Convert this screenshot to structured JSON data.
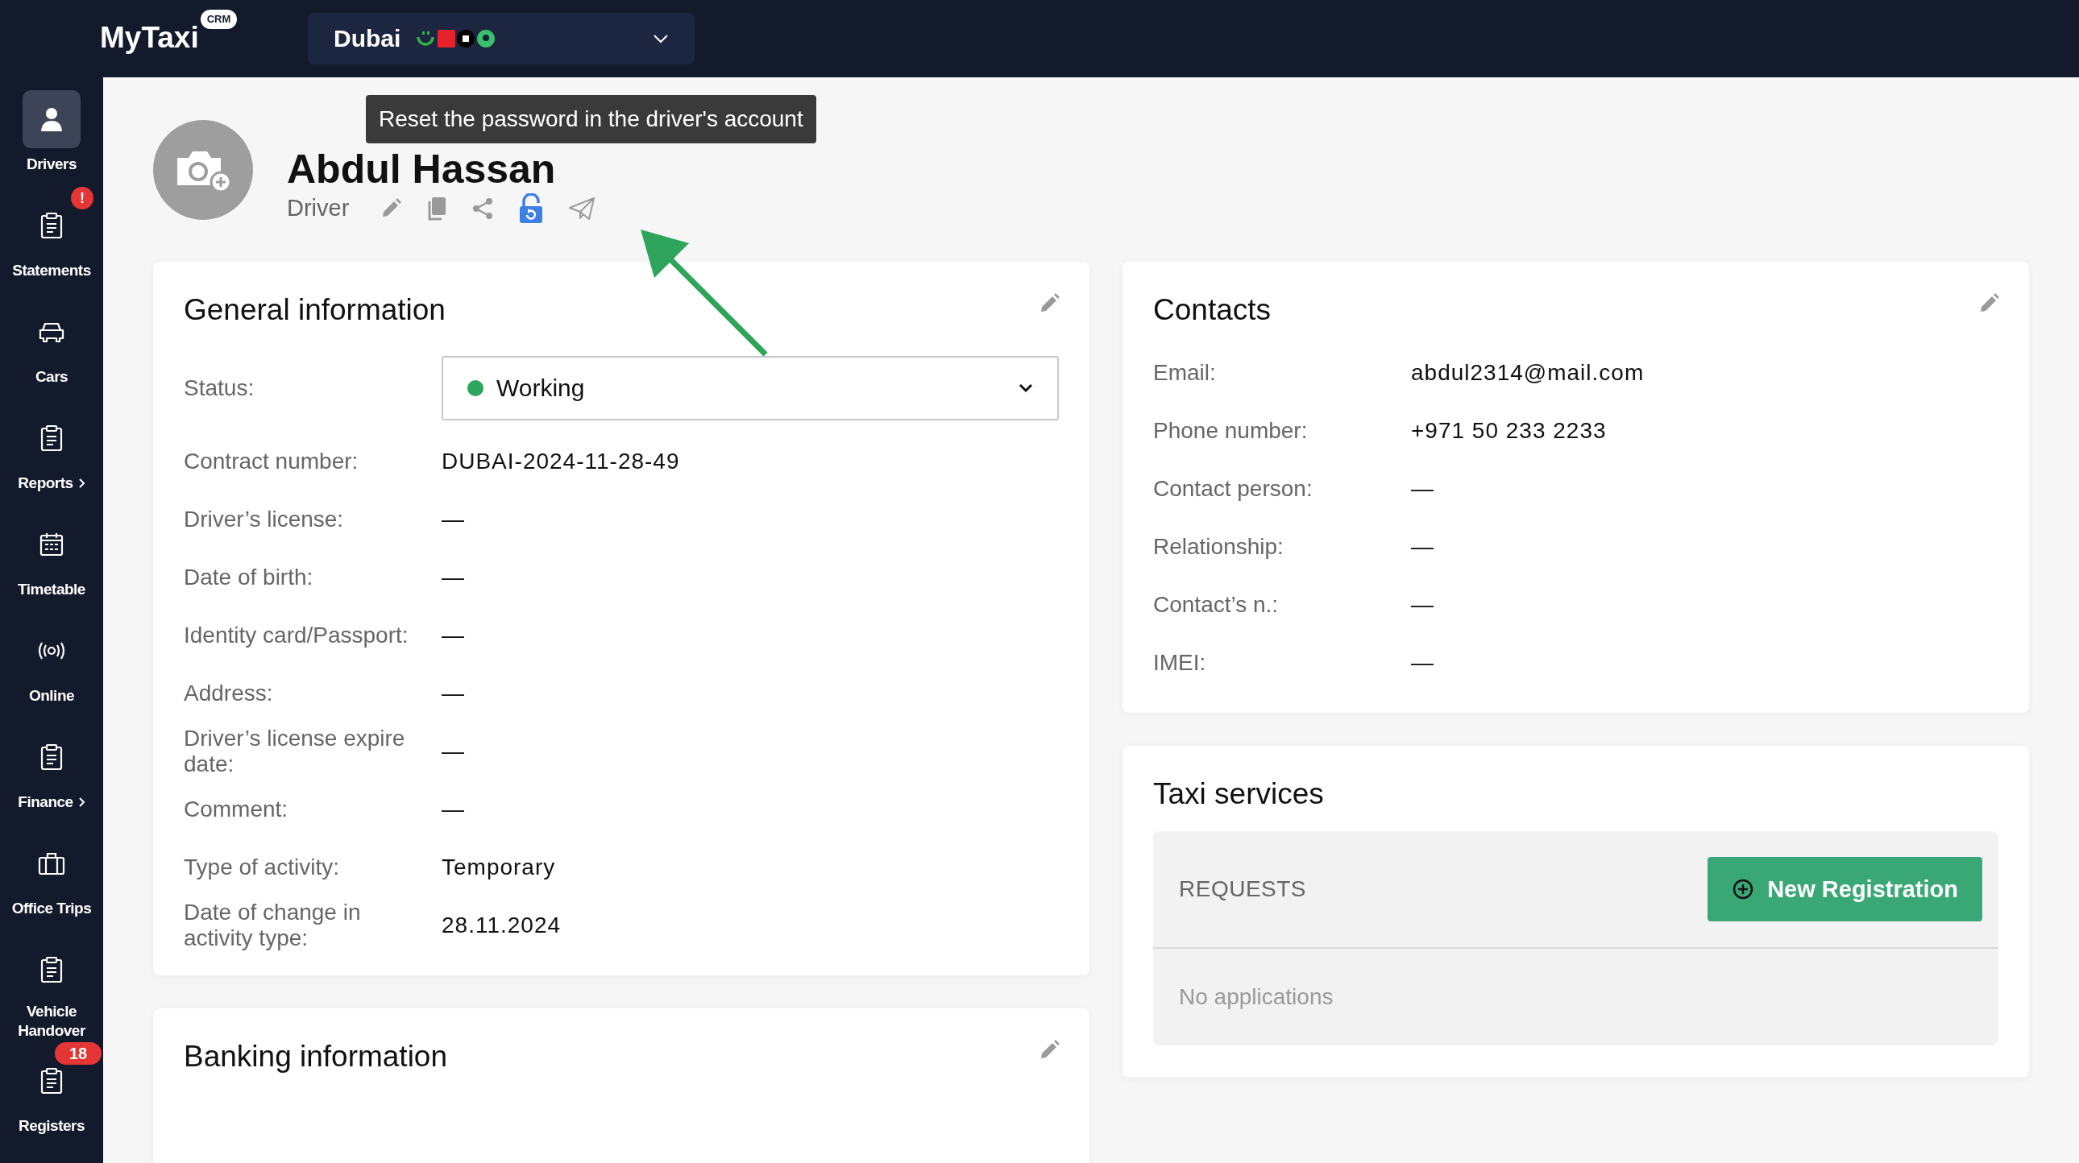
{
  "header": {
    "logo": "MyTaxi",
    "logo_badge": "CRM",
    "city": "Dubai"
  },
  "sidebar": {
    "items": [
      {
        "label": "Drivers",
        "selected": true
      },
      {
        "label": "Statements",
        "selected": false,
        "badge": "!"
      },
      {
        "label": "Cars",
        "selected": false
      },
      {
        "label": "Reports",
        "selected": false,
        "submenu": true
      },
      {
        "label": "Timetable",
        "selected": false
      },
      {
        "label": "Online",
        "selected": false
      },
      {
        "label": "Finance",
        "selected": false,
        "submenu": true
      },
      {
        "label": "Office Trips",
        "selected": false
      },
      {
        "label": "Vehicle Handover",
        "selected": false
      },
      {
        "label": "Registers",
        "selected": false,
        "badge": "18"
      }
    ]
  },
  "profile": {
    "name": "Abdul Hassan",
    "role": "Driver",
    "tooltip": "Reset the password in the driver's account",
    "actions": [
      {
        "kind": "edit",
        "hovered": false
      },
      {
        "kind": "copy",
        "hovered": false
      },
      {
        "kind": "share",
        "hovered": false
      },
      {
        "kind": "reset-password",
        "hovered": true
      },
      {
        "kind": "send",
        "hovered": false
      }
    ]
  },
  "general": {
    "title": "General information",
    "status": {
      "label": "Status:",
      "value": "Working",
      "color": "#2ea55a"
    },
    "rows": [
      {
        "label": "Contract number:",
        "value": "DUBAI-2024-11-28-49"
      },
      {
        "label": "Driver’s license:",
        "value": "—"
      },
      {
        "label": "Date of birth:",
        "value": "—"
      },
      {
        "label": "Identity card/Passport:",
        "value": "—"
      },
      {
        "label": "Address:",
        "value": "—"
      },
      {
        "label": "Driver’s license expire date:",
        "value": "—"
      },
      {
        "label": "Comment:",
        "value": "—"
      },
      {
        "label": "Type of activity:",
        "value": "Temporary"
      },
      {
        "label": "Date of change in activity type:",
        "value": "28.11.2024"
      }
    ]
  },
  "contacts": {
    "title": "Contacts",
    "rows": [
      {
        "label": "Email:",
        "value": "abdul2314@mail.com"
      },
      {
        "label": "Phone number:",
        "value": "+971 50 233 2233"
      },
      {
        "label": "Contact person:",
        "value": "—"
      },
      {
        "label": "Relationship:",
        "value": "—"
      },
      {
        "label": "Contact’s n.:",
        "value": "—"
      },
      {
        "label": "IMEI:",
        "value": "—"
      }
    ]
  },
  "taxi_services": {
    "title": "Taxi services",
    "section": "REQUESTS",
    "button": "New Registration",
    "empty": "No applications"
  },
  "banking": {
    "title": "Banking information"
  }
}
